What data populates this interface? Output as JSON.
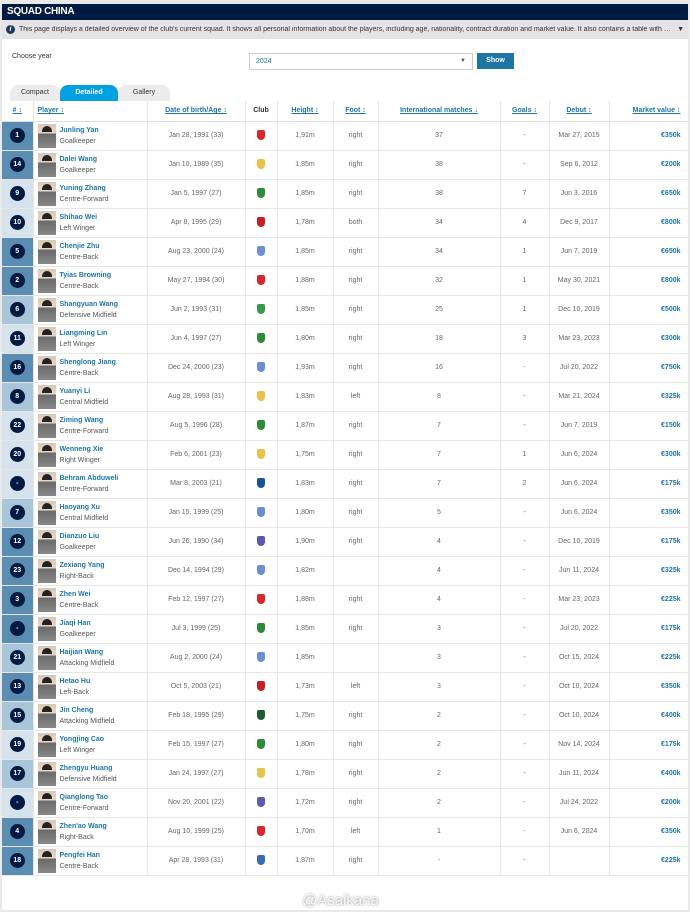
{
  "title": "SQUAD CHINA",
  "info": "This page displays a detailed overview of the club's current squad. It shows all personal information about the players, including age, nationality, contract duration and market value. It also contains a table with average age...",
  "choose_year_label": "Choose year",
  "year": "2024",
  "show_label": "Show",
  "tabs": [
    "Compact",
    "Detailed",
    "Gallery"
  ],
  "active_tab": "Detailed",
  "headers": [
    "# ↕",
    "Player ↕",
    "Date of birth/Age ↕",
    "Club",
    "Height ↕",
    "Foot ↕",
    "International matches ↓",
    "Goals ↕",
    "Debut ↕",
    "Market value ↕"
  ],
  "position_colors": {
    "gk_def": "#5b8db3",
    "mid": "#a8c5da",
    "fwd": "#d6e3ed"
  },
  "watermark": "@Asaikana",
  "players": [
    {
      "no": "1",
      "name": "Junling Yan",
      "pos": "Goalkeeper",
      "g": "gk_def",
      "dob": "Jan 28, 1991 (33)",
      "club": "#d8262a",
      "h": "1,91m",
      "foot": "right",
      "caps": "37",
      "goals": "-",
      "debut": "Mar 27, 2015",
      "val": "€350k"
    },
    {
      "no": "14",
      "name": "Dalei Wang",
      "pos": "Goalkeeper",
      "g": "gk_def",
      "dob": "Jan 10, 1989 (35)",
      "club": "#e8c24a",
      "h": "1,85m",
      "foot": "right",
      "caps": "38",
      "goals": "-",
      "debut": "Sep 6, 2012",
      "val": "€200k"
    },
    {
      "no": "9",
      "name": "Yuning Zhang",
      "pos": "Centre-Forward",
      "g": "fwd",
      "dob": "Jan 5, 1997 (27)",
      "club": "#2e8b3a",
      "h": "1,85m",
      "foot": "right",
      "caps": "38",
      "goals": "7",
      "debut": "Jun 3, 2016",
      "val": "€650k"
    },
    {
      "no": "10",
      "name": "Shihao Wei",
      "pos": "Left Winger",
      "g": "fwd",
      "dob": "Apr 8, 1995 (29)",
      "club": "#c8202a",
      "h": "1,78m",
      "foot": "both",
      "caps": "34",
      "goals": "4",
      "debut": "Dec 9, 2017",
      "val": "€800k"
    },
    {
      "no": "5",
      "name": "Chenjie Zhu",
      "pos": "Centre-Back",
      "g": "gk_def",
      "dob": "Aug 23, 2000 (24)",
      "club": "#6a8fd0",
      "h": "1,85m",
      "foot": "right",
      "caps": "34",
      "goals": "1",
      "debut": "Jun 7, 2019",
      "val": "€650k"
    },
    {
      "no": "2",
      "name": "Tyias Browning",
      "pos": "Centre-Back",
      "g": "gk_def",
      "dob": "May 27, 1994 (30)",
      "club": "#d8262a",
      "h": "1,88m",
      "foot": "right",
      "caps": "32",
      "goals": "1",
      "debut": "May 30, 2021",
      "val": "€800k"
    },
    {
      "no": "6",
      "name": "Shangyuan Wang",
      "pos": "Defensive Midfield",
      "g": "mid",
      "dob": "Jun 2, 1993 (31)",
      "club": "#3a9a4a",
      "h": "1,85m",
      "foot": "right",
      "caps": "25",
      "goals": "1",
      "debut": "Dec 10, 2019",
      "val": "€500k"
    },
    {
      "no": "11",
      "name": "Liangming Lin",
      "pos": "Left Winger",
      "g": "fwd",
      "dob": "Jun 4, 1997 (27)",
      "club": "#2e8b3a",
      "h": "1,80m",
      "foot": "right",
      "caps": "18",
      "goals": "3",
      "debut": "Mar 23, 2023",
      "val": "€300k"
    },
    {
      "no": "16",
      "name": "Shenglong Jiang",
      "pos": "Centre-Back",
      "g": "gk_def",
      "dob": "Dec 24, 2000 (23)",
      "club": "#6a8fd0",
      "h": "1,93m",
      "foot": "right",
      "caps": "16",
      "goals": "-",
      "debut": "Jul 20, 2022",
      "val": "€750k"
    },
    {
      "no": "8",
      "name": "Yuanyi Li",
      "pos": "Central Midfield",
      "g": "mid",
      "dob": "Aug 28, 1993 (31)",
      "club": "#e8c24a",
      "h": "1,83m",
      "foot": "left",
      "caps": "8",
      "goals": "-",
      "debut": "Mar 21, 2024",
      "val": "€325k"
    },
    {
      "no": "22",
      "name": "Ziming Wang",
      "pos": "Centre-Forward",
      "g": "fwd",
      "dob": "Aug 5, 1996 (28)",
      "club": "#2e8b3a",
      "h": "1,87m",
      "foot": "right",
      "caps": "7",
      "goals": "-",
      "debut": "Jun 7, 2019",
      "val": "€150k"
    },
    {
      "no": "20",
      "name": "Wenneng Xie",
      "pos": "Right Winger",
      "g": "fwd",
      "dob": "Feb 6, 2001 (23)",
      "club": "#e8c24a",
      "h": "1,75m",
      "foot": "right",
      "caps": "7",
      "goals": "1",
      "debut": "Jun 6, 2024",
      "val": "€300k"
    },
    {
      "no": "-",
      "name": "Behram Abduweli",
      "pos": "Centre-Forward",
      "g": "fwd",
      "dob": "Mar 8, 2003 (21)",
      "club": "#1d4f9a",
      "h": "1,83m",
      "foot": "right",
      "caps": "7",
      "goals": "2",
      "debut": "Jun 6, 2024",
      "val": "€175k"
    },
    {
      "no": "7",
      "name": "Haoyang Xu",
      "pos": "Central Midfield",
      "g": "mid",
      "dob": "Jan 15, 1999 (25)",
      "club": "#6a8fd0",
      "h": "1,80m",
      "foot": "right",
      "caps": "5",
      "goals": "-",
      "debut": "Jun 6, 2024",
      "val": "€350k"
    },
    {
      "no": "12",
      "name": "Dianzuo Liu",
      "pos": "Goalkeeper",
      "g": "gk_def",
      "dob": "Jun 26, 1990 (34)",
      "club": "#5a5ab0",
      "h": "1,90m",
      "foot": "right",
      "caps": "4",
      "goals": "-",
      "debut": "Dec 10, 2019",
      "val": "€175k"
    },
    {
      "no": "23",
      "name": "Zexiang Yang",
      "pos": "Right-Back",
      "g": "gk_def",
      "dob": "Dec 14, 1994 (29)",
      "club": "#6a8fd0",
      "h": "1,82m",
      "foot": "",
      "caps": "4",
      "goals": "-",
      "debut": "Jun 11, 2024",
      "val": "€325k"
    },
    {
      "no": "3",
      "name": "Zhen Wei",
      "pos": "Centre-Back",
      "g": "gk_def",
      "dob": "Feb 12, 1997 (27)",
      "club": "#d8262a",
      "h": "1,88m",
      "foot": "right",
      "caps": "4",
      "goals": "-",
      "debut": "Mar 23, 2023",
      "val": "€225k"
    },
    {
      "no": "-",
      "name": "Jiaqi Han",
      "pos": "Goalkeeper",
      "g": "gk_def",
      "dob": "Jul 3, 1999 (25)",
      "club": "#2e8b3a",
      "h": "1,85m",
      "foot": "right",
      "caps": "3",
      "goals": "-",
      "debut": "Jul 20, 2022",
      "val": "€175k"
    },
    {
      "no": "21",
      "name": "Haijian Wang",
      "pos": "Attacking Midfield",
      "g": "mid",
      "dob": "Aug 2, 2000 (24)",
      "club": "#6a8fd0",
      "h": "1,85m",
      "foot": "",
      "caps": "3",
      "goals": "-",
      "debut": "Oct 15, 2024",
      "val": "€225k"
    },
    {
      "no": "13",
      "name": "Hetao Hu",
      "pos": "Left-Back",
      "g": "gk_def",
      "dob": "Oct 5, 2003 (21)",
      "club": "#c8202a",
      "h": "1,73m",
      "foot": "left",
      "caps": "3",
      "goals": "-",
      "debut": "Oct 10, 2024",
      "val": "€350k"
    },
    {
      "no": "15",
      "name": "Jin Cheng",
      "pos": "Attacking Midfield",
      "g": "mid",
      "dob": "Feb 18, 1995 (29)",
      "club": "#1e5a2e",
      "h": "1,75m",
      "foot": "right",
      "caps": "2",
      "goals": "-",
      "debut": "Oct 10, 2024",
      "val": "€400k"
    },
    {
      "no": "19",
      "name": "Yongjing Cao",
      "pos": "Left Winger",
      "g": "fwd",
      "dob": "Feb 15, 1997 (27)",
      "club": "#2e8b3a",
      "h": "1,80m",
      "foot": "right",
      "caps": "2",
      "goals": "-",
      "debut": "Nov 14, 2024",
      "val": "€175k"
    },
    {
      "no": "17",
      "name": "Zhengyu Huang",
      "pos": "Defensive Midfield",
      "g": "mid",
      "dob": "Jan 24, 1997 (27)",
      "club": "#e8c24a",
      "h": "1,78m",
      "foot": "right",
      "caps": "2",
      "goals": "-",
      "debut": "Jun 11, 2024",
      "val": "€400k"
    },
    {
      "no": "-",
      "name": "Qianglong Tao",
      "pos": "Centre-Forward",
      "g": "fwd",
      "dob": "Nov 20, 2001 (22)",
      "club": "#5a5ab0",
      "h": "1,72m",
      "foot": "right",
      "caps": "2",
      "goals": "-",
      "debut": "Jul 24, 2022",
      "val": "€200k"
    },
    {
      "no": "4",
      "name": "Zhen'ao Wang",
      "pos": "Right-Back",
      "g": "gk_def",
      "dob": "Aug 10, 1999 (25)",
      "club": "#d8262a",
      "h": "1,70m",
      "foot": "left",
      "caps": "1",
      "goals": "-",
      "debut": "Jun 6, 2024",
      "val": "€350k"
    },
    {
      "no": "18",
      "name": "Pengfei Han",
      "pos": "Centre-Back",
      "g": "gk_def",
      "dob": "Apr 28, 1993 (31)",
      "club": "#3a6ab0",
      "h": "1,87m",
      "foot": "right",
      "caps": "-",
      "goals": "-",
      "debut": "",
      "val": "€225k"
    }
  ]
}
